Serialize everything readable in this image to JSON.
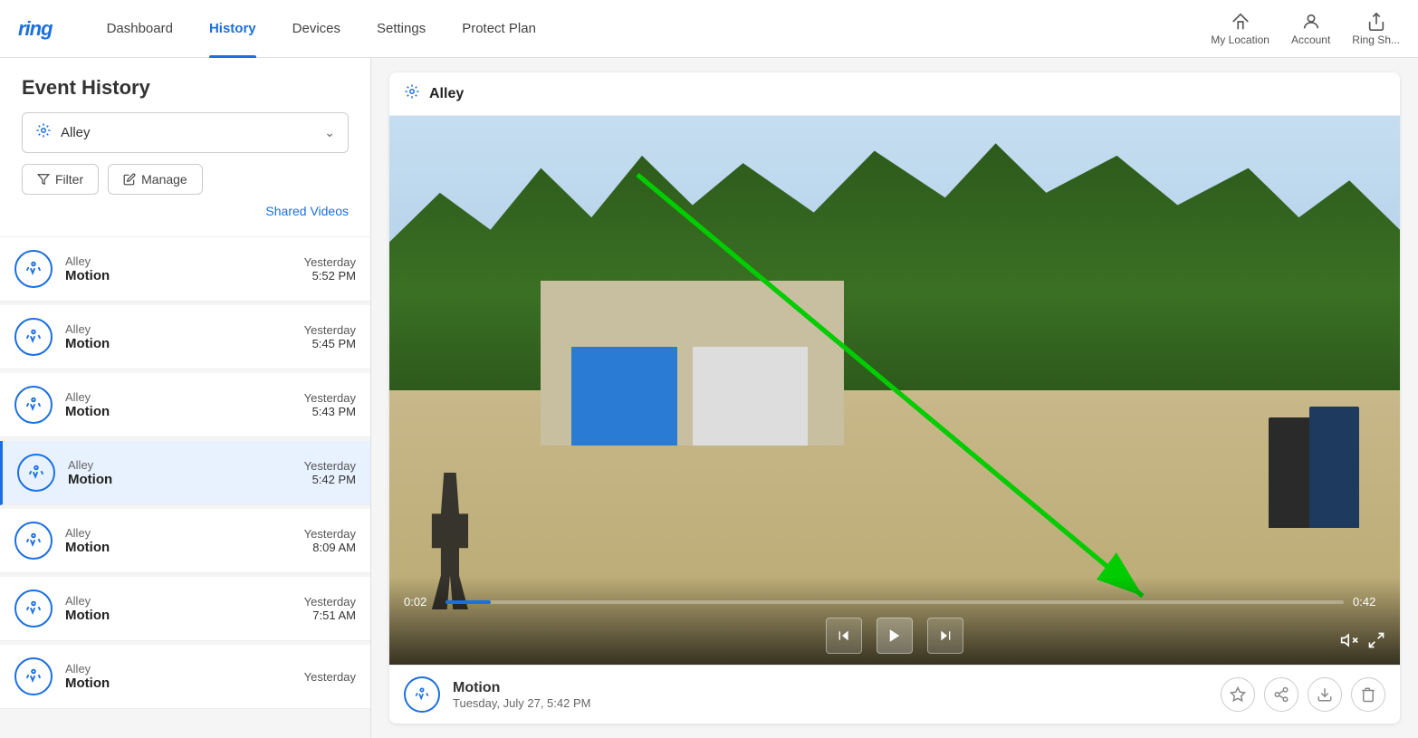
{
  "header": {
    "logo": "ring",
    "nav": [
      {
        "id": "dashboard",
        "label": "Dashboard",
        "active": false
      },
      {
        "id": "history",
        "label": "History",
        "active": true
      },
      {
        "id": "devices",
        "label": "Devices",
        "active": false
      },
      {
        "id": "settings",
        "label": "Settings",
        "active": false
      },
      {
        "id": "protect-plan",
        "label": "Protect Plan",
        "active": false
      }
    ],
    "right_actions": [
      {
        "id": "my-location",
        "label": "My Location",
        "icon": "home"
      },
      {
        "id": "account",
        "label": "Account",
        "icon": "person"
      },
      {
        "id": "ring-share",
        "label": "Ring Sh...",
        "icon": "share"
      }
    ]
  },
  "sidebar": {
    "title": "Event History",
    "device_select": {
      "label": "Alley",
      "icon": "motion"
    },
    "filter_btn": "Filter",
    "manage_btn": "Manage",
    "shared_videos_link": "Shared Videos",
    "events": [
      {
        "id": "ev1",
        "device": "Alley",
        "type": "Motion",
        "date": "Yesterday",
        "time": "5:52 PM",
        "active": false
      },
      {
        "id": "ev2",
        "device": "Alley",
        "type": "Motion",
        "date": "Yesterday",
        "time": "5:45 PM",
        "active": false
      },
      {
        "id": "ev3",
        "device": "Alley",
        "type": "Motion",
        "date": "Yesterday",
        "time": "5:43 PM",
        "active": false
      },
      {
        "id": "ev4",
        "device": "Alley",
        "type": "Motion",
        "date": "Yesterday",
        "time": "5:42 PM",
        "active": true
      },
      {
        "id": "ev5",
        "device": "Alley",
        "type": "Motion",
        "date": "Yesterday",
        "time": "8:09 AM",
        "active": false
      },
      {
        "id": "ev6",
        "device": "Alley",
        "type": "Motion",
        "date": "Yesterday",
        "time": "7:51 AM",
        "active": false
      },
      {
        "id": "ev7",
        "device": "Alley",
        "type": "Motion",
        "date": "Yesterday",
        "time": "",
        "active": false
      }
    ]
  },
  "video_panel": {
    "camera_name": "Alley",
    "progress": {
      "current": "0:02",
      "total": "0:42",
      "percent": 5
    },
    "footer": {
      "event_type": "Motion",
      "event_date": "Tuesday, July 27, 5:42 PM"
    },
    "actions": {
      "star": "star",
      "share": "share",
      "download": "download",
      "delete": "delete"
    }
  }
}
